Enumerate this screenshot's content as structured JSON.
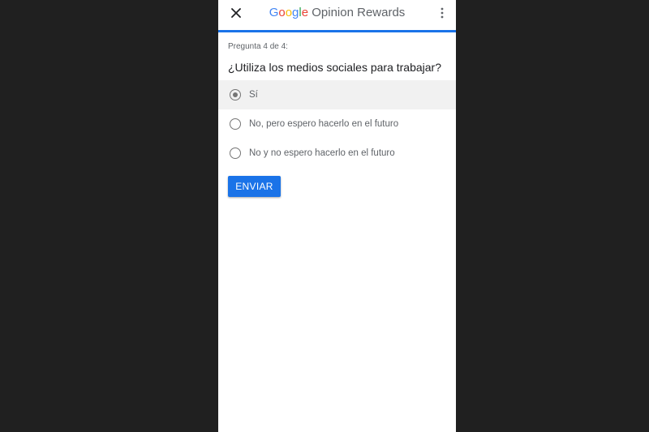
{
  "app": {
    "title_google": "Google",
    "title_rest": " Opinion Rewards",
    "brand_colors": [
      "#4285F4",
      "#EA4335",
      "#FBBC05",
      "#4285F4",
      "#34A853",
      "#EA4335"
    ]
  },
  "toolbar": {
    "close_icon": "close-icon",
    "more_icon": "more-vert-icon"
  },
  "survey": {
    "progress_fraction": 1.0,
    "step_text": "Pregunta 4 de 4:",
    "question": "¿Utiliza los medios sociales para trabajar?",
    "options": [
      {
        "label": "Sí",
        "selected": true
      },
      {
        "label": "No, pero espero hacerlo en el futuro",
        "selected": false
      },
      {
        "label": "No y no espero hacerlo en el futuro",
        "selected": false
      }
    ],
    "submit_label": "ENVIAR",
    "accent_color": "#1a73e8"
  }
}
